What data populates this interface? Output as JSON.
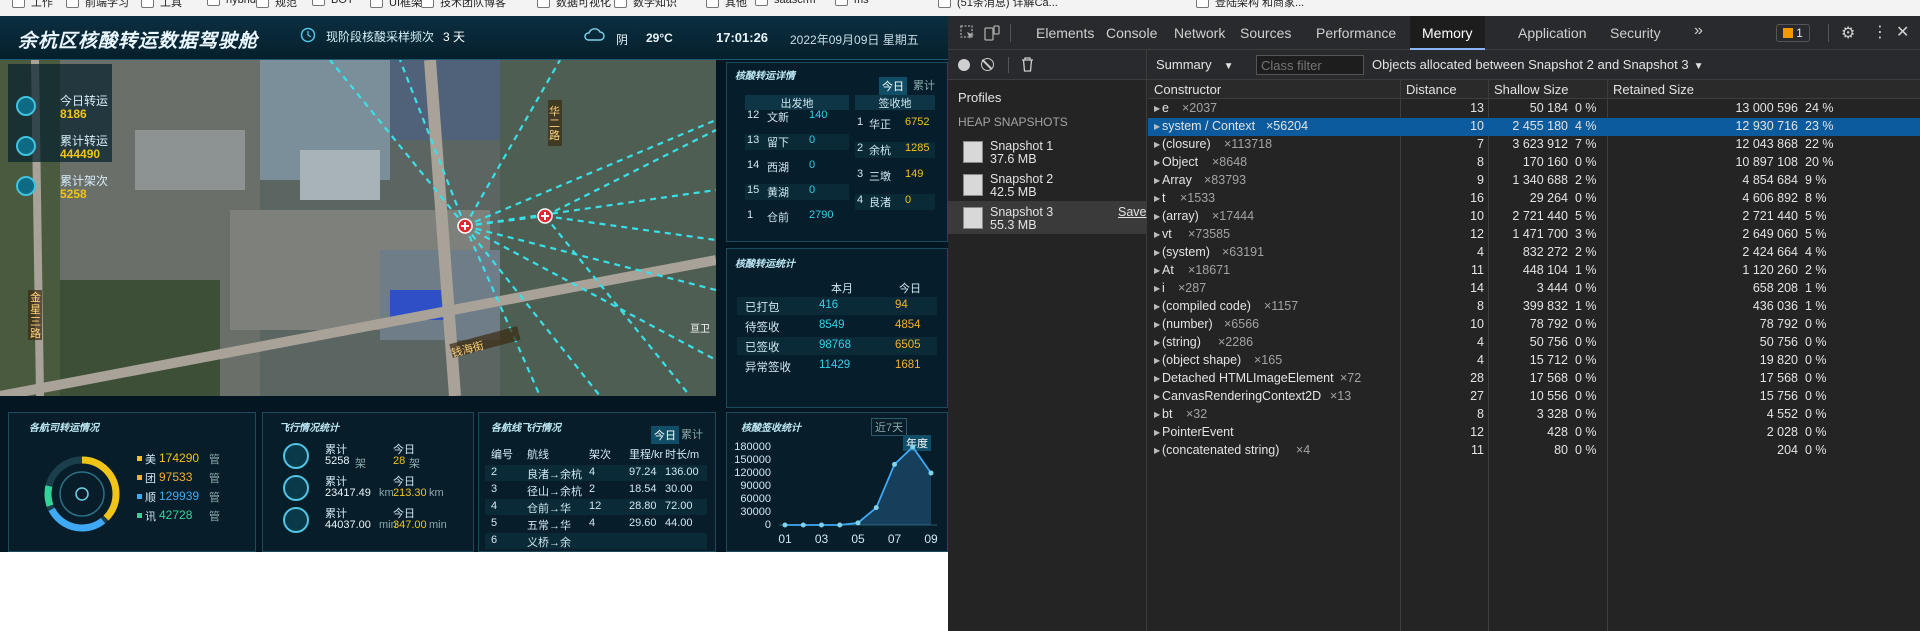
{
  "bookmarks": [
    "工作",
    "前端学习",
    "工具",
    "hybrid",
    "规范",
    "BOT",
    "UI框架",
    "技术团队博客",
    "数据可视化",
    "数学知识",
    "其他",
    "saascrm",
    "ms",
    "(51条消息) 详解Ca...",
    "登陆架构 和商家..."
  ],
  "dashboard": {
    "title": "余杭区核酸转运数据驾驶舱",
    "freq_label": "现阶段核酸采样频次",
    "freq_value": "3 天",
    "weather": "阴",
    "temp": "29°C",
    "time": "17:01:26",
    "date": "2022年09月09日 星期五",
    "left_stats": [
      {
        "label": "今日转运",
        "value": "8186"
      },
      {
        "label": "累计转运",
        "value": "444490"
      },
      {
        "label": "累计架次",
        "value": "5258"
      }
    ],
    "map_labels": {
      "road1": "华二路",
      "road2": "金星三路",
      "road3": "钱海街",
      "poi": "亘卫"
    },
    "detail_panel": {
      "title": "核酸转运详情",
      "tab_today": "今日",
      "tab_total": "累计",
      "col_from": "出发地",
      "col_to": "签收地",
      "from_rows": [
        [
          "12",
          "文新",
          "140"
        ],
        [
          "13",
          "留下",
          "0"
        ],
        [
          "14",
          "西湖",
          "0"
        ],
        [
          "15",
          "黄湖",
          "0"
        ],
        [
          "1",
          "仓前",
          "2790"
        ]
      ],
      "to_rows": [
        [
          "1",
          "华正",
          "6752"
        ],
        [
          "2",
          "余杭",
          "1285"
        ],
        [
          "3",
          "三墩",
          "149"
        ],
        [
          "4",
          "良渚",
          "0"
        ]
      ]
    },
    "stats_panel": {
      "title": "核酸转运统计",
      "col_month": "本月",
      "col_today": "今日",
      "rows": [
        {
          "label": "已打包",
          "month": "416",
          "today": "94"
        },
        {
          "label": "待签收",
          "month": "8549",
          "today": "4854"
        },
        {
          "label": "已签收",
          "month": "98768",
          "today": "6505"
        },
        {
          "label": "异常签收",
          "month": "11429",
          "today": "1681"
        }
      ]
    },
    "airline_panel": {
      "title": "各航司转运情况",
      "items": [
        {
          "name": "美",
          "value": "174290",
          "color": "#f0c419"
        },
        {
          "name": "团",
          "value": "97533",
          "color": "#f5b12b"
        },
        {
          "name": "顺",
          "value": "129939",
          "color": "#3fa9f5"
        },
        {
          "name": "讯",
          "value": "42728",
          "color": "#34d399"
        }
      ],
      "suffix": "管"
    },
    "flight_stats": {
      "title": "飞行情况统计",
      "rows": [
        {
          "label": "累计",
          "total": "5258",
          "unit1": "架",
          "today_label": "今日",
          "today": "28",
          "unit2": "架"
        },
        {
          "label": "累计",
          "total": "23417.49",
          "unit1": "km",
          "today_label": "今日",
          "today": "213.30",
          "unit2": "km"
        },
        {
          "label": "累计",
          "total": "44037.00",
          "unit1": "min",
          "today_label": "今日",
          "today": "347.00",
          "unit2": "min"
        }
      ]
    },
    "route_panel": {
      "title": "各航线飞行情况",
      "tab_today": "今日",
      "tab_total": "累计",
      "headers": [
        "编号",
        "航线",
        "架次",
        "里程/km",
        "时长/min"
      ],
      "rows": [
        {
          "no": "2",
          "route": "良渚→余杭",
          "count": "4",
          "km": "97.24",
          "min": "136.00"
        },
        {
          "no": "3",
          "route": "径山→余杭",
          "count": "2",
          "km": "18.54",
          "min": "30.00"
        },
        {
          "no": "4",
          "route": "仓前→华",
          "count": "12",
          "km": "28.80",
          "min": "72.00"
        },
        {
          "no": "5",
          "route": "五常→华",
          "count": "4",
          "km": "29.60",
          "min": "44.00"
        },
        {
          "no": "6",
          "route": "义桥→余",
          "count": "",
          "km": "",
          "min": ""
        }
      ]
    },
    "sign_panel": {
      "title": "核酸签收统计",
      "tab_7": "近7天",
      "tab_year": "年度"
    }
  },
  "chart_data": {
    "type": "line",
    "title": "",
    "x": [
      "01",
      "02",
      "03",
      "04",
      "05",
      "06",
      "07",
      "08",
      "09"
    ],
    "series": [
      {
        "values": [
          0,
          0,
          0,
          0,
          5000,
          40000,
          140000,
          180000,
          120000
        ]
      }
    ],
    "xlabel": "",
    "ylabel": "",
    "ylim": [
      0,
      180000
    ],
    "yticks": [
      "180000",
      "150000",
      "120000",
      "90000",
      "60000",
      "30000",
      "0"
    ],
    "xticks": [
      "01",
      "03",
      "05",
      "07",
      "09"
    ]
  },
  "devtools": {
    "tabs": [
      "Elements",
      "Console",
      "Network",
      "Sources",
      "Performance",
      "Memory",
      "Application",
      "Security"
    ],
    "active_tab": "Memory",
    "issues_count": "1",
    "summary_label": "Summary",
    "class_filter_placeholder": "Class filter",
    "snapshot_filter": "Objects allocated between Snapshot 2 and Snapshot 3",
    "profiles_label": "Profiles",
    "heap_label": "HEAP SNAPSHOTS",
    "save_label": "Save",
    "snapshots": [
      {
        "name": "Snapshot 1",
        "size": "37.6 MB"
      },
      {
        "name": "Snapshot 2",
        "size": "42.5 MB"
      },
      {
        "name": "Snapshot 3",
        "size": "55.3 MB"
      }
    ],
    "columns": [
      "Constructor",
      "Distance",
      "Shallow Size",
      "Retained Size"
    ],
    "rows": [
      {
        "name": "e",
        "count": "×2037",
        "distance": "13",
        "shallow": "50 184",
        "shallow_pct": "0 %",
        "retained": "13 000 596",
        "retained_pct": "24 %"
      },
      {
        "name": "system / Context",
        "count": "×56204",
        "distance": "10",
        "shallow": "2 455 180",
        "shallow_pct": "4 %",
        "retained": "12 930 716",
        "retained_pct": "23 %"
      },
      {
        "name": "(closure)",
        "count": "×113718",
        "distance": "7",
        "shallow": "3 623 912",
        "shallow_pct": "7 %",
        "retained": "12 043 868",
        "retained_pct": "22 %"
      },
      {
        "name": "Object",
        "count": "×8648",
        "distance": "8",
        "shallow": "170 160",
        "shallow_pct": "0 %",
        "retained": "10 897 108",
        "retained_pct": "20 %"
      },
      {
        "name": "Array",
        "count": "×83793",
        "distance": "9",
        "shallow": "1 340 688",
        "shallow_pct": "2 %",
        "retained": "4 854 684",
        "retained_pct": "9 %"
      },
      {
        "name": "t",
        "count": "×1533",
        "distance": "16",
        "shallow": "29 264",
        "shallow_pct": "0 %",
        "retained": "4 606 892",
        "retained_pct": "8 %"
      },
      {
        "name": "(array)",
        "count": "×17444",
        "distance": "10",
        "shallow": "2 721 440",
        "shallow_pct": "5 %",
        "retained": "2 721 440",
        "retained_pct": "5 %"
      },
      {
        "name": "vt",
        "count": "×73585",
        "distance": "12",
        "shallow": "1 471 700",
        "shallow_pct": "3 %",
        "retained": "2 649 060",
        "retained_pct": "5 %"
      },
      {
        "name": "(system)",
        "count": "×63191",
        "distance": "4",
        "shallow": "832 272",
        "shallow_pct": "2 %",
        "retained": "2 424 664",
        "retained_pct": "4 %"
      },
      {
        "name": "At",
        "count": "×18671",
        "distance": "11",
        "shallow": "448 104",
        "shallow_pct": "1 %",
        "retained": "1 120 260",
        "retained_pct": "2 %"
      },
      {
        "name": "i",
        "count": "×287",
        "distance": "14",
        "shallow": "3 444",
        "shallow_pct": "0 %",
        "retained": "658 208",
        "retained_pct": "1 %"
      },
      {
        "name": "(compiled code)",
        "count": "×1157",
        "distance": "8",
        "shallow": "399 832",
        "shallow_pct": "1 %",
        "retained": "436 036",
        "retained_pct": "1 %"
      },
      {
        "name": "(number)",
        "count": "×6566",
        "distance": "10",
        "shallow": "78 792",
        "shallow_pct": "0 %",
        "retained": "78 792",
        "retained_pct": "0 %"
      },
      {
        "name": "(string)",
        "count": "×2286",
        "distance": "4",
        "shallow": "50 756",
        "shallow_pct": "0 %",
        "retained": "50 756",
        "retained_pct": "0 %"
      },
      {
        "name": "(object shape)",
        "count": "×165",
        "distance": "4",
        "shallow": "15 712",
        "shallow_pct": "0 %",
        "retained": "19 820",
        "retained_pct": "0 %"
      },
      {
        "name": "Detached HTMLImageElement",
        "count": "×72",
        "distance": "28",
        "shallow": "17 568",
        "shallow_pct": "0 %",
        "retained": "17 568",
        "retained_pct": "0 %"
      },
      {
        "name": "CanvasRenderingContext2D",
        "count": "×13",
        "distance": "27",
        "shallow": "10 556",
        "shallow_pct": "0 %",
        "retained": "15 756",
        "retained_pct": "0 %"
      },
      {
        "name": "bt",
        "count": "×32",
        "distance": "8",
        "shallow": "3 328",
        "shallow_pct": "0 %",
        "retained": "4 552",
        "retained_pct": "0 %"
      },
      {
        "name": "PointerEvent",
        "count": "",
        "distance": "12",
        "shallow": "428",
        "shallow_pct": "0 %",
        "retained": "2 028",
        "retained_pct": "0 %"
      },
      {
        "name": "(concatenated string)",
        "count": "×4",
        "distance": "11",
        "shallow": "80",
        "shallow_pct": "0 %",
        "retained": "204",
        "retained_pct": "0 %"
      }
    ]
  }
}
